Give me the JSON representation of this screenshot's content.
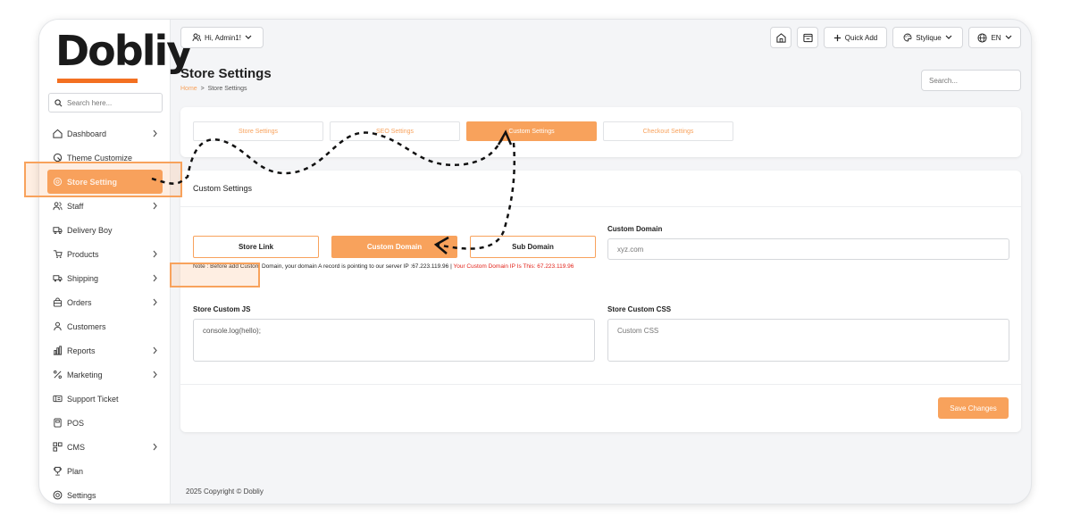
{
  "brand": {
    "logo_text": "Dobliy",
    "accent": "#f8a25c",
    "highlight": "#f37021"
  },
  "sidebar": {
    "search_placeholder": "Search here...",
    "items": [
      {
        "label": "Dashboard",
        "icon": "home-icon",
        "chevron": true
      },
      {
        "label": "Theme Customize",
        "icon": "customize-icon",
        "chevron": false
      },
      {
        "label": "Store Setting",
        "icon": "gear-icon",
        "chevron": false,
        "active": true
      },
      {
        "label": "Staff",
        "icon": "users-icon",
        "chevron": true
      },
      {
        "label": "Delivery Boy",
        "icon": "truck-icon",
        "chevron": false
      },
      {
        "label": "Products",
        "icon": "products-icon",
        "chevron": true
      },
      {
        "label": "Shipping",
        "icon": "shipping-icon",
        "chevron": true
      },
      {
        "label": "Orders",
        "icon": "bag-icon",
        "chevron": true
      },
      {
        "label": "Customers",
        "icon": "user-icon",
        "chevron": false
      },
      {
        "label": "Reports",
        "icon": "chart-icon",
        "chevron": true
      },
      {
        "label": "Marketing",
        "icon": "marketing-icon",
        "chevron": true
      },
      {
        "label": "Support Ticket",
        "icon": "ticket-icon",
        "chevron": false
      },
      {
        "label": "POS",
        "icon": "pos-icon",
        "chevron": false
      },
      {
        "label": "CMS",
        "icon": "cms-icon",
        "chevron": true
      },
      {
        "label": "Plan",
        "icon": "trophy-icon",
        "chevron": false
      },
      {
        "label": "Settings",
        "icon": "settings-icon",
        "chevron": false
      }
    ]
  },
  "topbar": {
    "user_label": "Hi, Admin1!",
    "quick_add_label": "Quick Add",
    "theme_label": "Stylique",
    "language_label": "EN"
  },
  "page": {
    "title": "Store Settings",
    "breadcrumb_home": "Home",
    "breadcrumb_sep": ">",
    "breadcrumb_current": "Store Settings",
    "search_placeholder": "Search..."
  },
  "tabs": [
    {
      "label": "Store Settings"
    },
    {
      "label": "SEO Settings"
    },
    {
      "label": "Custom Settings",
      "active": true
    },
    {
      "label": "Checkout Settings"
    }
  ],
  "custom": {
    "heading": "Custom Settings",
    "domain_buttons": [
      {
        "label": "Store Link"
      },
      {
        "label": "Custom Domain",
        "active": true
      },
      {
        "label": "Sub Domain"
      }
    ],
    "note_text": "Note : Before add Custom Domain, your domain A record is pointing to our server IP :67.223.119.96 | ",
    "note_red": "Your Custom Domain IP Is This: 67.223.119.96",
    "custom_domain_label": "Custom Domain",
    "custom_domain_placeholder": "xyz.com",
    "js_label": "Store Custom JS",
    "js_value": "console.log(hello);",
    "css_label": "Store Custom CSS",
    "css_placeholder": "Custom CSS",
    "save_label": "Save Changes"
  },
  "footer": {
    "copyright": "2025 Copyright © Dobliy"
  }
}
